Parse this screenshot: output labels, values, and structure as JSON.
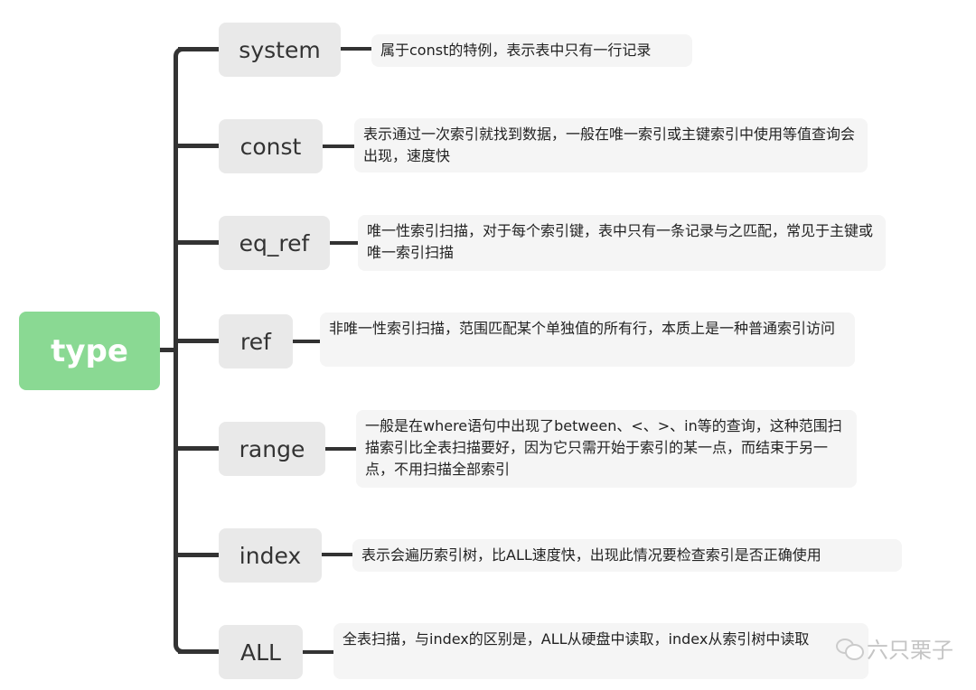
{
  "root": {
    "label": "type",
    "color": "#8ad993"
  },
  "nodes": [
    {
      "label": "system",
      "description": "属于const的特例，表示表中只有一行记录"
    },
    {
      "label": "const",
      "description": "表示通过一次索引就找到数据，一般在唯一索引或主键索引中使用等值查询会出现，速度快"
    },
    {
      "label": "eq_ref",
      "description": "唯一性索引扫描，对于每个索引键，表中只有一条记录与之匹配，常见于主键或唯一索引扫描"
    },
    {
      "label": "ref",
      "description": "非唯一性索引扫描，范围匹配某个单独值的所有行，本质上是一种普通索引访问"
    },
    {
      "label": "range",
      "description": "一般是在where语句中出现了between、<、>、in等的查询，这种范围扫描索引比全表扫描要好，因为它只需开始于索引的某一点，而结束于另一点，不用扫描全部索引"
    },
    {
      "label": "index",
      "description": "表示会遍历索引树，比ALL速度快，出现此情况要检查索引是否正确使用"
    },
    {
      "label": "ALL",
      "description": "全表扫描，与index的区别是，ALL从硬盘中读取，index从索引树中读取"
    }
  ],
  "watermark": {
    "text": "六只栗子",
    "icon": "wechat-icon"
  }
}
